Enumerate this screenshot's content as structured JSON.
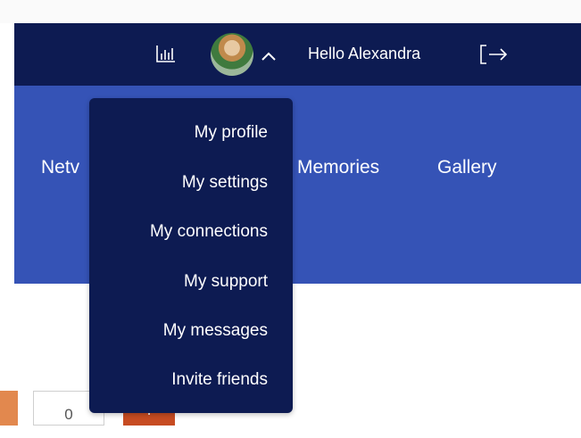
{
  "header": {
    "greeting": "Hello Alexandra",
    "icons": {
      "stats": "bar-chart-icon",
      "avatar_toggle": "chevron-up-icon",
      "logout": "logout-icon"
    }
  },
  "nav": {
    "items": [
      {
        "label": "Netv"
      },
      {
        "label": "Memories"
      },
      {
        "label": "Gallery"
      }
    ]
  },
  "user_menu": {
    "items": [
      {
        "label": "My profile"
      },
      {
        "label": "My settings"
      },
      {
        "label": "My connections"
      },
      {
        "label": "My support"
      },
      {
        "label": "My messages"
      },
      {
        "label": "Invite friends"
      }
    ]
  },
  "quantity": {
    "value": "0",
    "increment_label": "+"
  },
  "colors": {
    "header_bg": "#0d1b52",
    "nav_bg": "#3553b6",
    "accent_orange": "#c74c22",
    "menu_bg": "#0d1b52"
  }
}
